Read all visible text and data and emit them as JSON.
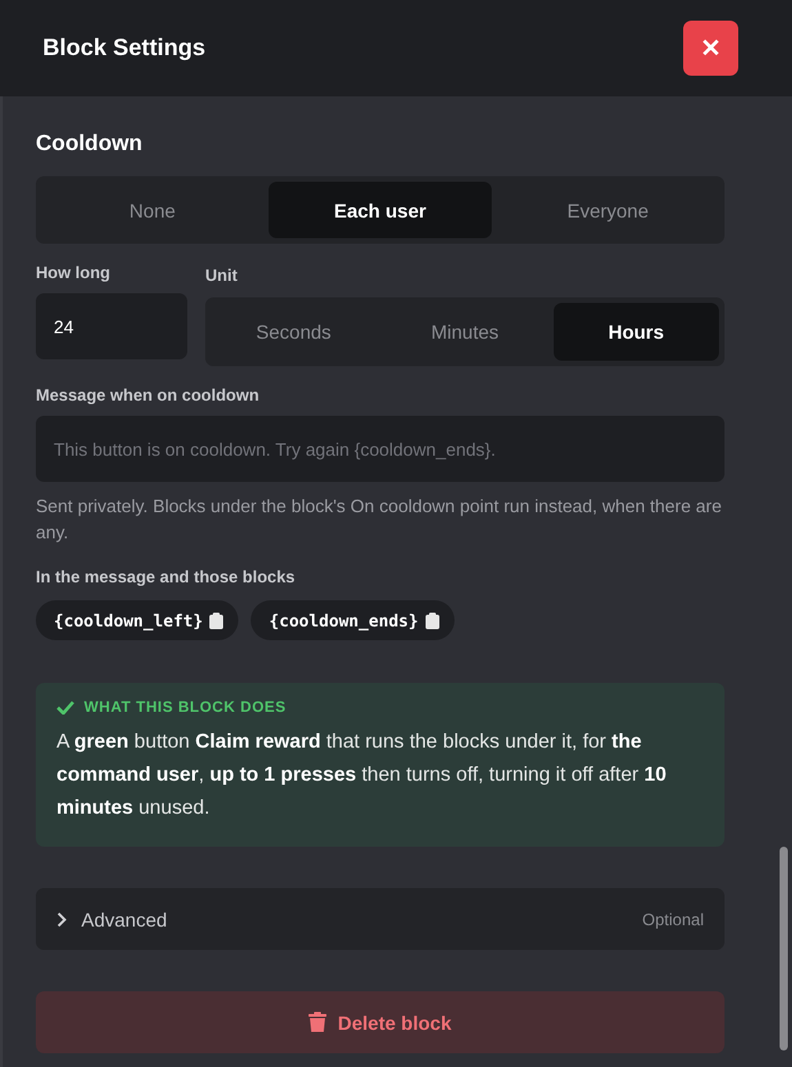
{
  "header": {
    "title": "Block Settings",
    "close_label": "✕"
  },
  "section": {
    "title": "Cooldown",
    "scope": [
      {
        "label": "None",
        "selected": false
      },
      {
        "label": "Each user",
        "selected": true
      },
      {
        "label": "Everyone",
        "selected": false
      }
    ],
    "how_long": {
      "label": "How long",
      "value": "24"
    },
    "unit": {
      "label": "Unit",
      "options": [
        {
          "label": "Seconds",
          "selected": false
        },
        {
          "label": "Minutes",
          "selected": false
        },
        {
          "label": "Hours",
          "selected": true
        }
      ]
    },
    "message": {
      "label": "Message when on cooldown",
      "placeholder": "This button is on cooldown. Try again {cooldown_ends}."
    },
    "help": "Sent privately. Blocks under the block's On cooldown point run instead, when there are any.",
    "variables_label": "In the message and those blocks",
    "variables": [
      "{cooldown_left}",
      "{cooldown_ends}"
    ]
  },
  "summary": {
    "title": "WHAT THIS BLOCK DOES",
    "text": "A **green** button **Claim reward** that runs the blocks under it, for **the command user**, **up to 1 presses** then turns off, turning it off after **10 minutes** unused."
  },
  "advanced": {
    "label": "Advanced",
    "hint": "Optional",
    "expanded": false
  },
  "delete_label": "Delete block"
}
